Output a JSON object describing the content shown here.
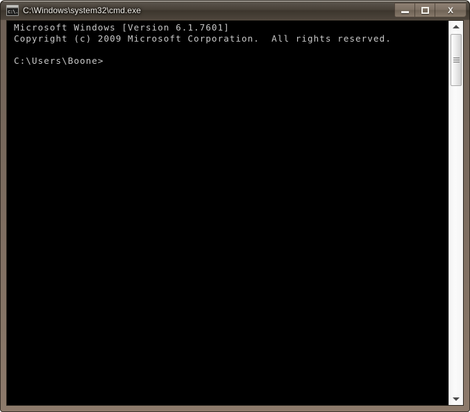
{
  "window": {
    "title": "C:\\Windows\\system32\\cmd.exe",
    "icon_name": "cmd-console-icon",
    "icon_glyph": "c:\\.",
    "frame_color": "#8d7a6b",
    "titlebar_color": "#443d34",
    "title_text_color": "#f2efe9"
  },
  "controls": {
    "minimize_label": "–",
    "maximize_label": "□",
    "close_label": "X"
  },
  "console": {
    "background_color": "#000000",
    "text_color": "#c8c8c8",
    "lines": [
      "Microsoft Windows [Version 6.1.7601]",
      "Copyright (c) 2009 Microsoft Corporation.  All rights reserved.",
      "",
      "C:\\Users\\Boone>"
    ],
    "text": "Microsoft Windows [Version 6.1.7601]\nCopyright (c) 2009 Microsoft Corporation.  All rights reserved.\n\nC:\\Users\\Boone>"
  },
  "scrollbar": {
    "up_arrow_name": "scroll-up-arrow",
    "down_arrow_name": "scroll-down-arrow",
    "thumb_name": "scrollbar-thumb",
    "position": "top"
  }
}
